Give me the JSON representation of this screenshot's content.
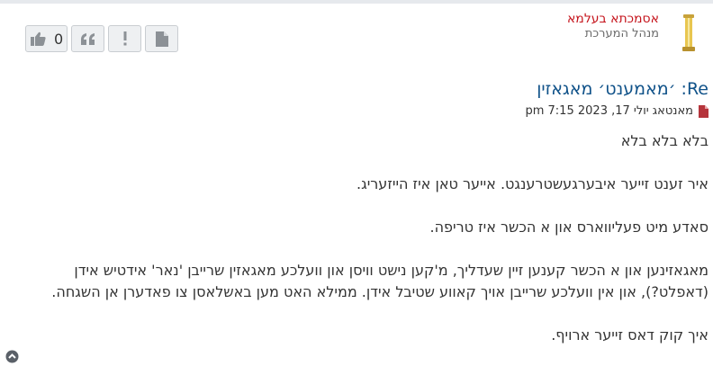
{
  "author": {
    "name": "אסמכתא בעלמא",
    "rank": "מנהל המערכת"
  },
  "actions": {
    "like_count": "0",
    "like_icon": "thumbs-up-icon",
    "quote_icon": "quote-icon",
    "report_icon": "exclamation-icon",
    "file_icon": "file-icon"
  },
  "post": {
    "title": "Re: ׳מאמענט׳ מאגאזין",
    "date": "מאנטאג יולי 17, 2023 7:15 pm",
    "paragraphs": [
      "בלא בלא בלא",
      "איר זענט זייער איבערגעשטרענגט. אייער טאן איז הייזעריג.",
      "סאדע מיט פעליווארס און א הכשר איז טריפה.",
      "מאגאזינען און א הכשר קענען זיין שעדליך, מ'קען נישט וויסן און וועלכע מאגאזין שרייבן 'נאר' אידטיש אידן (דאפלט?), און אין וועלכע שרייבן אויך קאווע שטיבל אידן. ממילא האט מען באשלאסן צו פאדערן אן השגחה.",
      "איך קוק דאס זייער ארויף."
    ]
  },
  "colors": {
    "author_name": "#c5141c",
    "title": "#105289",
    "button_bg": "#eef0f2",
    "icon": "#8c9196"
  }
}
